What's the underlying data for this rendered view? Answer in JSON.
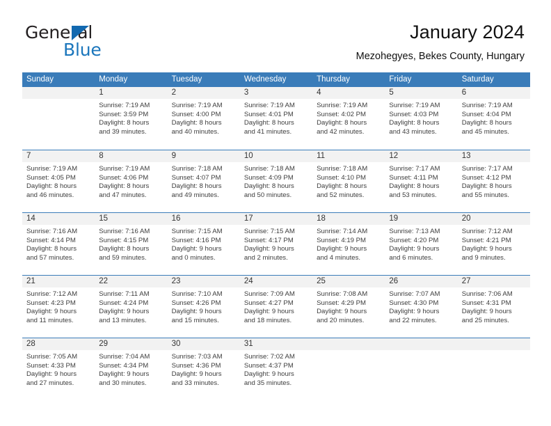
{
  "logo": {
    "word1": "General",
    "word2": "Blue",
    "triangle_color": "#1269b0",
    "blue_text_color": "#1b76bc"
  },
  "header": {
    "title": "January 2024",
    "subtitle": "Mezohegyes, Bekes County, Hungary"
  },
  "theme": {
    "header_bar_color": "#3a7cb9",
    "daynum_band_color": "#f2f2f2",
    "grid_line_color": "#3a7cb9"
  },
  "weekdays": [
    "Sunday",
    "Monday",
    "Tuesday",
    "Wednesday",
    "Thursday",
    "Friday",
    "Saturday"
  ],
  "calendar": {
    "month": "January",
    "year": "2024",
    "weeks": [
      [
        {
          "day": "",
          "empty": true
        },
        {
          "day": "1",
          "sunrise": "Sunrise: 7:19 AM",
          "sunset": "Sunset: 3:59 PM",
          "daylight1": "Daylight: 8 hours",
          "daylight2": "and 39 minutes."
        },
        {
          "day": "2",
          "sunrise": "Sunrise: 7:19 AM",
          "sunset": "Sunset: 4:00 PM",
          "daylight1": "Daylight: 8 hours",
          "daylight2": "and 40 minutes."
        },
        {
          "day": "3",
          "sunrise": "Sunrise: 7:19 AM",
          "sunset": "Sunset: 4:01 PM",
          "daylight1": "Daylight: 8 hours",
          "daylight2": "and 41 minutes."
        },
        {
          "day": "4",
          "sunrise": "Sunrise: 7:19 AM",
          "sunset": "Sunset: 4:02 PM",
          "daylight1": "Daylight: 8 hours",
          "daylight2": "and 42 minutes."
        },
        {
          "day": "5",
          "sunrise": "Sunrise: 7:19 AM",
          "sunset": "Sunset: 4:03 PM",
          "daylight1": "Daylight: 8 hours",
          "daylight2": "and 43 minutes."
        },
        {
          "day": "6",
          "sunrise": "Sunrise: 7:19 AM",
          "sunset": "Sunset: 4:04 PM",
          "daylight1": "Daylight: 8 hours",
          "daylight2": "and 45 minutes."
        }
      ],
      [
        {
          "day": "7",
          "sunrise": "Sunrise: 7:19 AM",
          "sunset": "Sunset: 4:05 PM",
          "daylight1": "Daylight: 8 hours",
          "daylight2": "and 46 minutes."
        },
        {
          "day": "8",
          "sunrise": "Sunrise: 7:19 AM",
          "sunset": "Sunset: 4:06 PM",
          "daylight1": "Daylight: 8 hours",
          "daylight2": "and 47 minutes."
        },
        {
          "day": "9",
          "sunrise": "Sunrise: 7:18 AM",
          "sunset": "Sunset: 4:07 PM",
          "daylight1": "Daylight: 8 hours",
          "daylight2": "and 49 minutes."
        },
        {
          "day": "10",
          "sunrise": "Sunrise: 7:18 AM",
          "sunset": "Sunset: 4:09 PM",
          "daylight1": "Daylight: 8 hours",
          "daylight2": "and 50 minutes."
        },
        {
          "day": "11",
          "sunrise": "Sunrise: 7:18 AM",
          "sunset": "Sunset: 4:10 PM",
          "daylight1": "Daylight: 8 hours",
          "daylight2": "and 52 minutes."
        },
        {
          "day": "12",
          "sunrise": "Sunrise: 7:17 AM",
          "sunset": "Sunset: 4:11 PM",
          "daylight1": "Daylight: 8 hours",
          "daylight2": "and 53 minutes."
        },
        {
          "day": "13",
          "sunrise": "Sunrise: 7:17 AM",
          "sunset": "Sunset: 4:12 PM",
          "daylight1": "Daylight: 8 hours",
          "daylight2": "and 55 minutes."
        }
      ],
      [
        {
          "day": "14",
          "sunrise": "Sunrise: 7:16 AM",
          "sunset": "Sunset: 4:14 PM",
          "daylight1": "Daylight: 8 hours",
          "daylight2": "and 57 minutes."
        },
        {
          "day": "15",
          "sunrise": "Sunrise: 7:16 AM",
          "sunset": "Sunset: 4:15 PM",
          "daylight1": "Daylight: 8 hours",
          "daylight2": "and 59 minutes."
        },
        {
          "day": "16",
          "sunrise": "Sunrise: 7:15 AM",
          "sunset": "Sunset: 4:16 PM",
          "daylight1": "Daylight: 9 hours",
          "daylight2": "and 0 minutes."
        },
        {
          "day": "17",
          "sunrise": "Sunrise: 7:15 AM",
          "sunset": "Sunset: 4:17 PM",
          "daylight1": "Daylight: 9 hours",
          "daylight2": "and 2 minutes."
        },
        {
          "day": "18",
          "sunrise": "Sunrise: 7:14 AM",
          "sunset": "Sunset: 4:19 PM",
          "daylight1": "Daylight: 9 hours",
          "daylight2": "and 4 minutes."
        },
        {
          "day": "19",
          "sunrise": "Sunrise: 7:13 AM",
          "sunset": "Sunset: 4:20 PM",
          "daylight1": "Daylight: 9 hours",
          "daylight2": "and 6 minutes."
        },
        {
          "day": "20",
          "sunrise": "Sunrise: 7:12 AM",
          "sunset": "Sunset: 4:21 PM",
          "daylight1": "Daylight: 9 hours",
          "daylight2": "and 9 minutes."
        }
      ],
      [
        {
          "day": "21",
          "sunrise": "Sunrise: 7:12 AM",
          "sunset": "Sunset: 4:23 PM",
          "daylight1": "Daylight: 9 hours",
          "daylight2": "and 11 minutes."
        },
        {
          "day": "22",
          "sunrise": "Sunrise: 7:11 AM",
          "sunset": "Sunset: 4:24 PM",
          "daylight1": "Daylight: 9 hours",
          "daylight2": "and 13 minutes."
        },
        {
          "day": "23",
          "sunrise": "Sunrise: 7:10 AM",
          "sunset": "Sunset: 4:26 PM",
          "daylight1": "Daylight: 9 hours",
          "daylight2": "and 15 minutes."
        },
        {
          "day": "24",
          "sunrise": "Sunrise: 7:09 AM",
          "sunset": "Sunset: 4:27 PM",
          "daylight1": "Daylight: 9 hours",
          "daylight2": "and 18 minutes."
        },
        {
          "day": "25",
          "sunrise": "Sunrise: 7:08 AM",
          "sunset": "Sunset: 4:29 PM",
          "daylight1": "Daylight: 9 hours",
          "daylight2": "and 20 minutes."
        },
        {
          "day": "26",
          "sunrise": "Sunrise: 7:07 AM",
          "sunset": "Sunset: 4:30 PM",
          "daylight1": "Daylight: 9 hours",
          "daylight2": "and 22 minutes."
        },
        {
          "day": "27",
          "sunrise": "Sunrise: 7:06 AM",
          "sunset": "Sunset: 4:31 PM",
          "daylight1": "Daylight: 9 hours",
          "daylight2": "and 25 minutes."
        }
      ],
      [
        {
          "day": "28",
          "sunrise": "Sunrise: 7:05 AM",
          "sunset": "Sunset: 4:33 PM",
          "daylight1": "Daylight: 9 hours",
          "daylight2": "and 27 minutes."
        },
        {
          "day": "29",
          "sunrise": "Sunrise: 7:04 AM",
          "sunset": "Sunset: 4:34 PM",
          "daylight1": "Daylight: 9 hours",
          "daylight2": "and 30 minutes."
        },
        {
          "day": "30",
          "sunrise": "Sunrise: 7:03 AM",
          "sunset": "Sunset: 4:36 PM",
          "daylight1": "Daylight: 9 hours",
          "daylight2": "and 33 minutes."
        },
        {
          "day": "31",
          "sunrise": "Sunrise: 7:02 AM",
          "sunset": "Sunset: 4:37 PM",
          "daylight1": "Daylight: 9 hours",
          "daylight2": "and 35 minutes."
        },
        {
          "day": "",
          "empty": true
        },
        {
          "day": "",
          "empty": true
        },
        {
          "day": "",
          "empty": true
        }
      ]
    ]
  }
}
